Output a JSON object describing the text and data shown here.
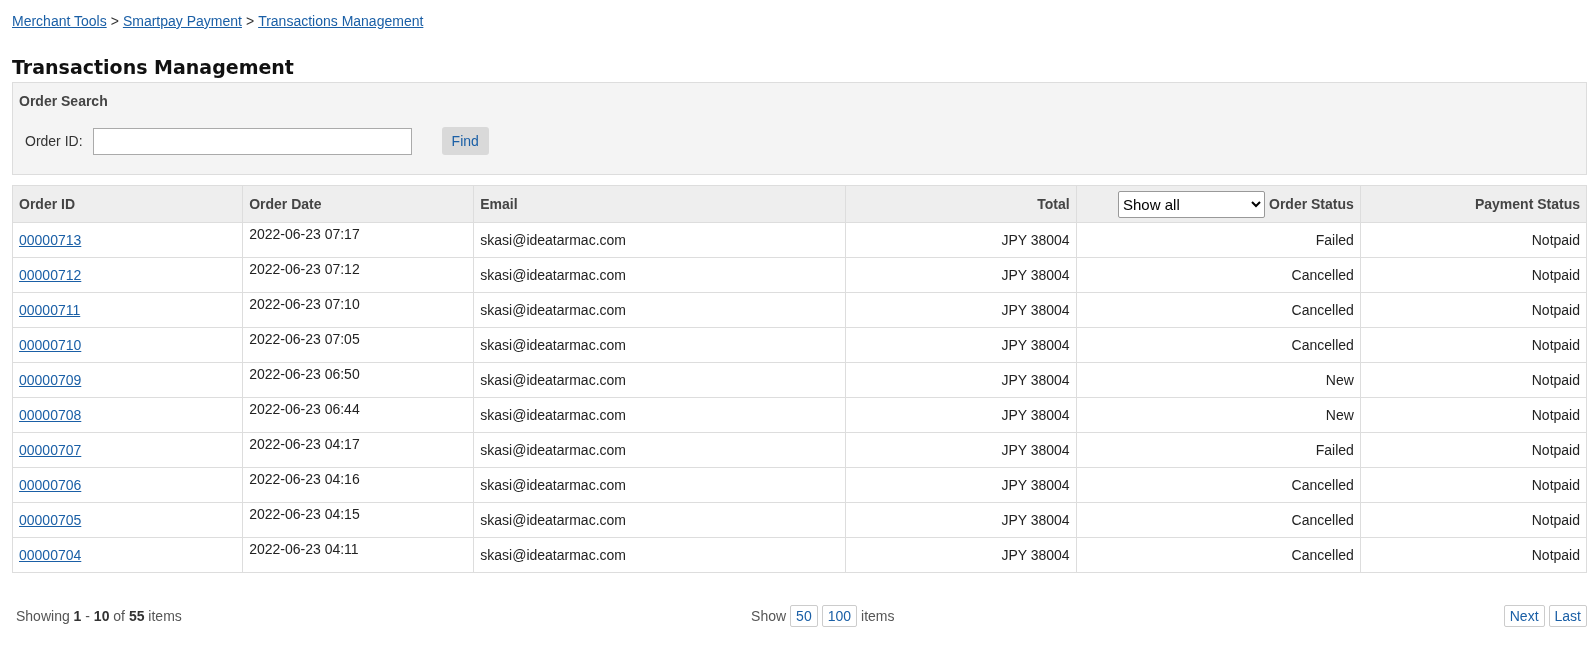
{
  "breadcrumb": [
    "Merchant Tools",
    "Smartpay Payment",
    "Transactions Management"
  ],
  "breadcrumb_separator": ">",
  "title": "Transactions Management",
  "order_search": {
    "title": "Order Search",
    "label": "Order ID:",
    "button": "Find"
  },
  "table": {
    "columns": [
      "Order ID",
      "Order Date",
      "Email",
      "Total",
      "Order Status",
      "Payment Status"
    ],
    "status_filter": "Show all",
    "rows": [
      {
        "order_id": "00000713",
        "date": "2022-06-23 07:17",
        "email": "skasi@ideatarmac.com",
        "total": "JPY 38004",
        "order_status": "Failed",
        "payment_status": "Notpaid"
      },
      {
        "order_id": "00000712",
        "date": "2022-06-23 07:12",
        "email": "skasi@ideatarmac.com",
        "total": "JPY 38004",
        "order_status": "Cancelled",
        "payment_status": "Notpaid"
      },
      {
        "order_id": "00000711",
        "date": "2022-06-23 07:10",
        "email": "skasi@ideatarmac.com",
        "total": "JPY 38004",
        "order_status": "Cancelled",
        "payment_status": "Notpaid"
      },
      {
        "order_id": "00000710",
        "date": "2022-06-23 07:05",
        "email": "skasi@ideatarmac.com",
        "total": "JPY 38004",
        "order_status": "Cancelled",
        "payment_status": "Notpaid"
      },
      {
        "order_id": "00000709",
        "date": "2022-06-23 06:50",
        "email": "skasi@ideatarmac.com",
        "total": "JPY 38004",
        "order_status": "New",
        "payment_status": "Notpaid"
      },
      {
        "order_id": "00000708",
        "date": "2022-06-23 06:44",
        "email": "skasi@ideatarmac.com",
        "total": "JPY 38004",
        "order_status": "New",
        "payment_status": "Notpaid"
      },
      {
        "order_id": "00000707",
        "date": "2022-06-23 04:17",
        "email": "skasi@ideatarmac.com",
        "total": "JPY 38004",
        "order_status": "Failed",
        "payment_status": "Notpaid"
      },
      {
        "order_id": "00000706",
        "date": "2022-06-23 04:16",
        "email": "skasi@ideatarmac.com",
        "total": "JPY 38004",
        "order_status": "Cancelled",
        "payment_status": "Notpaid"
      },
      {
        "order_id": "00000705",
        "date": "2022-06-23 04:15",
        "email": "skasi@ideatarmac.com",
        "total": "JPY 38004",
        "order_status": "Cancelled",
        "payment_status": "Notpaid"
      },
      {
        "order_id": "00000704",
        "date": "2022-06-23 04:11",
        "email": "skasi@ideatarmac.com",
        "total": "JPY 38004",
        "order_status": "Cancelled",
        "payment_status": "Notpaid"
      }
    ]
  },
  "footer": {
    "showing": "Showing  **1** - **10** of **55** items",
    "show_label": "Show",
    "page_sizes": [
      "50",
      "100"
    ],
    "items_label": "items",
    "nav": [
      "Next",
      "Last"
    ]
  }
}
